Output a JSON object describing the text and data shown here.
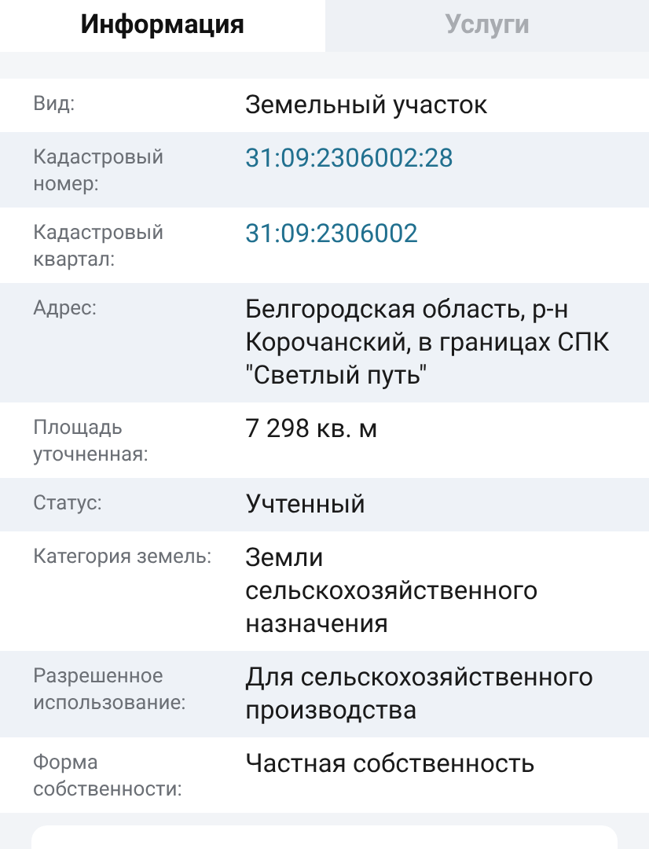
{
  "tabs": [
    {
      "label": "Информация",
      "selected": true
    },
    {
      "label": "Услуги",
      "selected": false
    }
  ],
  "rows": [
    {
      "label": "Вид:",
      "value": "Земельный участок",
      "kind": "text"
    },
    {
      "label": "Кадастровый номер:",
      "value": "31:09:2306002:28",
      "kind": "link"
    },
    {
      "label": "Кадастровый квартал:",
      "value": "31:09:2306002",
      "kind": "link"
    },
    {
      "label": "Адрес:",
      "value": "Белгородская область, р-н Корочанский, в границах СПК \"Светлый путь\"",
      "kind": "text"
    },
    {
      "label": "Площадь уточненная:",
      "value": "7 298 кв. м",
      "kind": "text"
    },
    {
      "label": "Статус:",
      "value": "Учтенный",
      "kind": "text"
    },
    {
      "label": "Категория земель:",
      "value": "Земли сельскохозяйственного назначения",
      "kind": "text"
    },
    {
      "label": "Разрешенное использование:",
      "value": "Для сельскохозяйственного производства",
      "kind": "text"
    },
    {
      "label": "Форма собственности:",
      "value": "Частная собственность",
      "kind": "text"
    }
  ]
}
